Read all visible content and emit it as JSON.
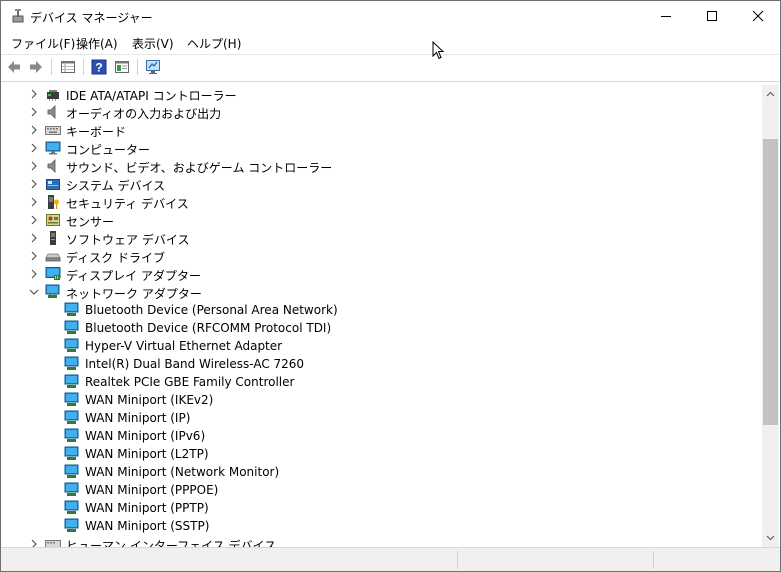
{
  "window": {
    "title": "デバイス マネージャー"
  },
  "menu": [
    {
      "label": "ファイル(F)"
    },
    {
      "label": "操作(A)"
    },
    {
      "label": "表示(V)"
    },
    {
      "label": "ヘルプ(H)"
    }
  ],
  "toolbar": {
    "icons": [
      "back-arrow-icon",
      "forward-arrow-icon",
      "properties-grid-icon",
      "help-icon",
      "view-pane-icon",
      "monitor-scan-icon"
    ]
  },
  "tree": {
    "categories": [
      {
        "label": "IDE ATA/ATAPI コントローラー",
        "icon": "ide-controller-icon",
        "expanded": false
      },
      {
        "label": "オーディオの入力および出力",
        "icon": "speaker-icon",
        "expanded": false
      },
      {
        "label": "キーボード",
        "icon": "keyboard-icon",
        "expanded": false
      },
      {
        "label": "コンピューター",
        "icon": "computer-icon",
        "expanded": false
      },
      {
        "label": "サウンド、ビデオ、およびゲーム コントローラー",
        "icon": "speaker-icon",
        "expanded": false
      },
      {
        "label": "システム デバイス",
        "icon": "system-device-icon",
        "expanded": false
      },
      {
        "label": "セキュリティ デバイス",
        "icon": "security-device-icon",
        "expanded": false
      },
      {
        "label": "センサー",
        "icon": "sensor-icon",
        "expanded": false
      },
      {
        "label": "ソフトウェア デバイス",
        "icon": "software-device-icon",
        "expanded": false
      },
      {
        "label": "ディスク ドライブ",
        "icon": "disk-drive-icon",
        "expanded": false
      },
      {
        "label": "ディスプレイ アダプター",
        "icon": "display-adapter-icon",
        "expanded": false
      },
      {
        "label": "ネットワーク アダプター",
        "icon": "network-adapter-icon",
        "expanded": true
      }
    ],
    "network_adapters": [
      {
        "label": "Bluetooth Device (Personal Area Network)"
      },
      {
        "label": "Bluetooth Device (RFCOMM Protocol TDI)"
      },
      {
        "label": "Hyper-V Virtual Ethernet Adapter"
      },
      {
        "label": "Intel(R) Dual Band Wireless-AC 7260"
      },
      {
        "label": "Realtek PCIe GBE Family Controller"
      },
      {
        "label": "WAN Miniport (IKEv2)"
      },
      {
        "label": "WAN Miniport (IP)"
      },
      {
        "label": "WAN Miniport (IPv6)"
      },
      {
        "label": "WAN Miniport (L2TP)"
      },
      {
        "label": "WAN Miniport (Network Monitor)"
      },
      {
        "label": "WAN Miniport (PPPOE)"
      },
      {
        "label": "WAN Miniport (PPTP)"
      },
      {
        "label": "WAN Miniport (SSTP)"
      }
    ],
    "after": [
      {
        "label": "ヒューマン インターフェイス デバイス",
        "icon": "hid-icon",
        "expanded": false
      }
    ]
  }
}
